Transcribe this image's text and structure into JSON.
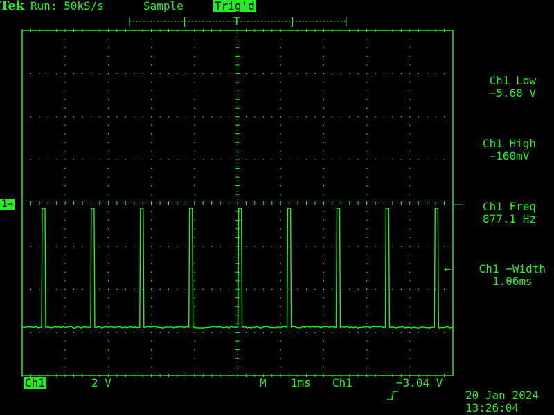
{
  "header": {
    "brand": "Tek",
    "run_status": "Run: 50kS/s",
    "acq_mode": "Sample",
    "trig_status": "Trig'd"
  },
  "measurements": [
    {
      "name": "Ch1 Low",
      "value": "−5.68 V"
    },
    {
      "name": "Ch1 High",
      "value": "−160mV"
    },
    {
      "name": "Ch1 Freq",
      "value": "877.1 Hz"
    },
    {
      "name": "Ch1 −Width",
      "value": "1.06ms"
    }
  ],
  "channel_marker": "1→",
  "measurement_pointer": "←",
  "footer": {
    "channel": "Ch1",
    "volts_div": "2 V",
    "m_label": "M",
    "time_div": "1ms",
    "trig_channel": "Ch1",
    "trig_slope_icon": "rising-edge-icon",
    "trig_level": "−3.04 V",
    "date": "20 Jan 2024",
    "time": "13:26:04"
  },
  "colors": {
    "trace": "#22ee22",
    "background": "#000000"
  },
  "chart_data": {
    "type": "line",
    "title": "",
    "xlabel": "",
    "ylabel": "",
    "grid": true,
    "series": [
      {
        "name": "Ch1",
        "description_units": "x in ms from left edge of screen, y in volts",
        "pulse_count": 9,
        "low_level_v": -5.68,
        "high_level_v": -0.16,
        "frequency_hz": 877.1,
        "negative_width_ms": 1.06
      }
    ],
    "xlim": [
      0,
      10
    ],
    "ylim": [
      -8,
      8
    ]
  }
}
